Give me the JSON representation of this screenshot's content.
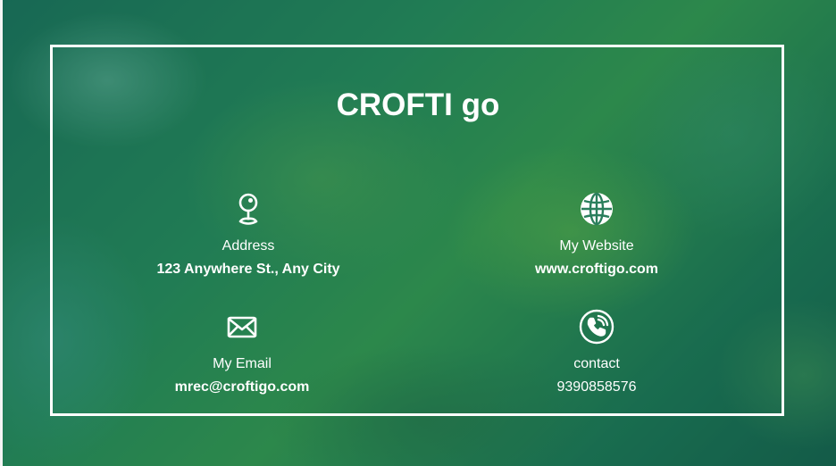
{
  "title": "CROFTI go",
  "address": {
    "icon": "location-pin-icon",
    "label": "Address",
    "value": "123 Anywhere St., Any City"
  },
  "website": {
    "icon": "globe-icon",
    "label": "My Website",
    "value": "www.croftigo.com"
  },
  "email": {
    "icon": "envelope-icon",
    "label": "My Email",
    "value": "mrec@croftigo.com"
  },
  "contact": {
    "icon": "phone-icon",
    "label": "contact",
    "value": "9390858576"
  },
  "colors": {
    "text": "#ffffff",
    "frame": "#ffffff",
    "background": "#2a8a5a"
  }
}
